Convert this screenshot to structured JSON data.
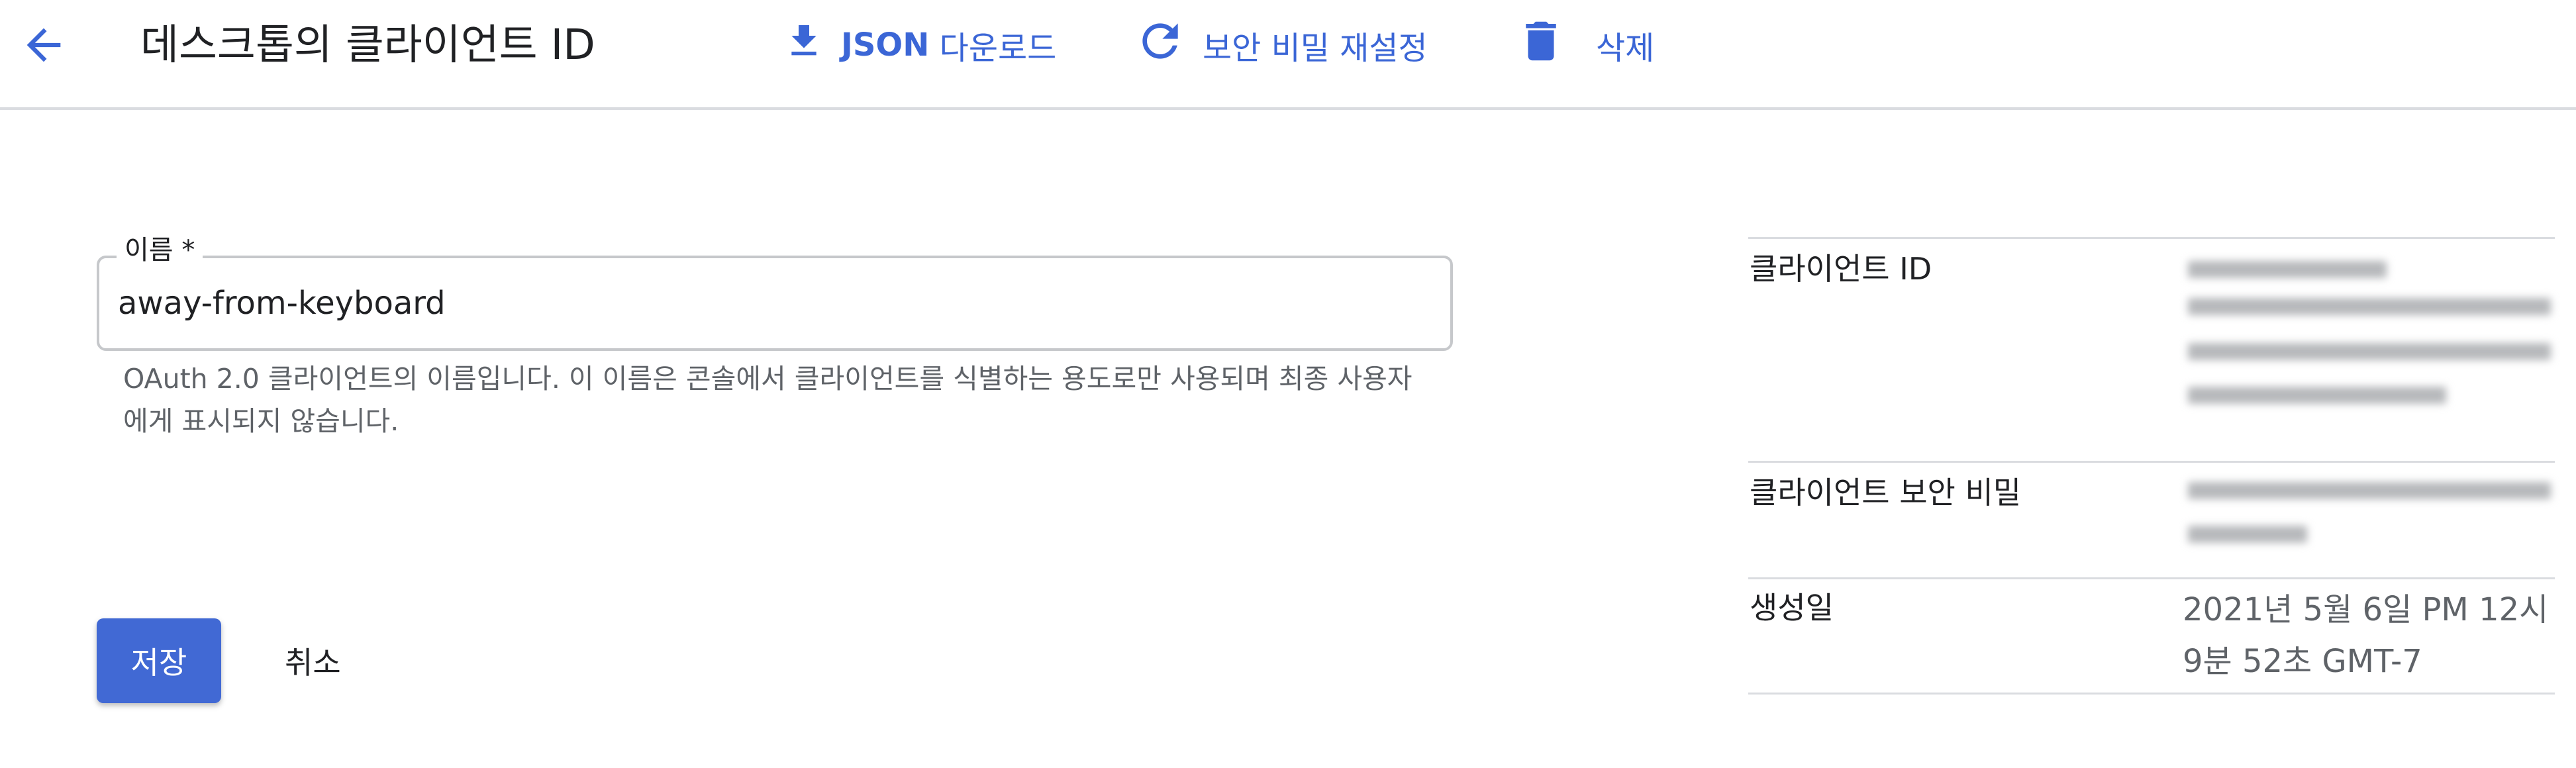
{
  "header": {
    "back_icon": "arrow-back-icon",
    "title": "데스크톱의 클라이언트 ID",
    "actions": {
      "json_download": {
        "icon": "download-icon",
        "label_bold": "JSON",
        "label_rest": " 다운로드"
      },
      "reset_secret": {
        "icon": "refresh-icon",
        "label": "보안 비밀 재설정"
      },
      "delete": {
        "icon": "trash-icon",
        "label": "삭제"
      }
    }
  },
  "form": {
    "name_label": "이름 *",
    "name_value": "away-from-keyboard",
    "help_text": "OAuth 2.0 클라이언트의 이름입니다. 이 이름은 콘솔에서 클라이언트를 식별하는 용도로만 사용되며 최종 사용자에게 표시되지 않습니다."
  },
  "buttons": {
    "save": "저장",
    "cancel": "취소"
  },
  "details": {
    "client_id_label": "클라이언트 ID",
    "client_secret_label": "클라이언트 보안 비밀",
    "created_label": "생성일",
    "created_value_line1": "2021년 5월 6일 PM 12시",
    "created_value_line2": "9분 52초 GMT-7"
  },
  "colors": {
    "accent": "#3b66d6",
    "primary_button": "#4169d4",
    "divider": "#dadce0",
    "secondary_text": "#5f6368"
  }
}
